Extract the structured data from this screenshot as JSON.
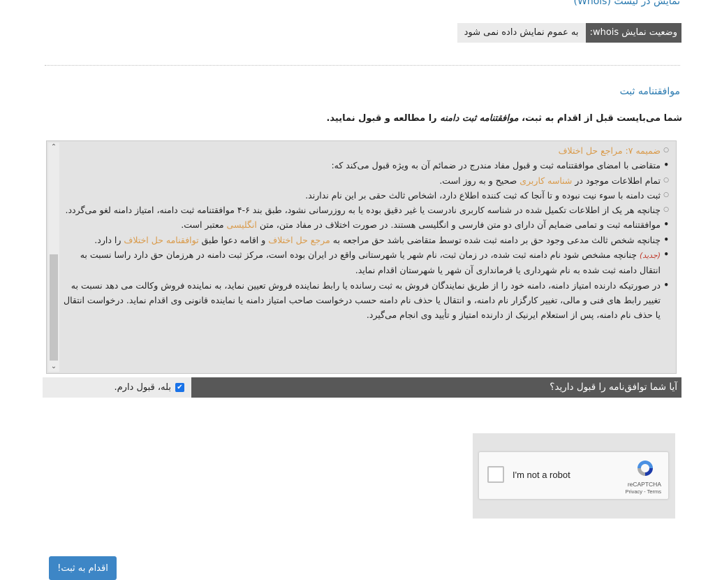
{
  "whois": {
    "title": "نمایش در لیست (Whois)",
    "status_label": "وضعیت نمایش whois:",
    "status_value": "به عموم نمایش داده نمی شود"
  },
  "agreement": {
    "title": "موافقتنامه ثبت",
    "intro_part1": "شما می‌بایست قبل از اقدام به ثبت، ",
    "intro_link": "موافقتنامه ثبت دامنه",
    "intro_part2": " را مطالعه و قبول نمایید.",
    "items": {
      "annex7": "ضمیمه ۷: مراجع حل اختلاف",
      "applicant": "متقاضی با امضای موافقتنامه ثبت و قبول مفاد مندرج در ضمائم آن به ویژه قبول می‌کند که:",
      "info_a": "تمام اطلاعات موجود در ",
      "info_link": "شناسه کاربری",
      "info_b": " صحیح و به روز است.",
      "third_party": "ثبت دامنه با سوء نیت نبوده و تا آنجا که ثبت کننده اطلاع دارد، اشخاص ثالث حقی بر این نام ندارند.",
      "cancel": "چنانچه هر یک از اطلاعات تکمیل شده در شناسه کاربری نادرست یا غیر دقیق بوده یا به روزرسانی نشود، طبق بند ۶-۴ موافقتنامه ثبت دامنه، امتیاز دامنه لغو می‌گردد.",
      "lang_a": "موافقتنامه ثبت و تمامی ضمایم آن دارای دو متن فارسی و انگلیسی هستند. در صورت اختلاف در مفاد متن، متن ",
      "lang_link": "انگلیسی",
      "lang_b": " معتبر است.",
      "claim_a": "چنانچه شخص ثالث مدعی وجود حق بر دامنه ثبت شده توسط متقاضی باشد حق مراجعه به ",
      "claim_link1": "مرجع حل اختلاف",
      "claim_b": " و اقامه دعوا طبق ",
      "claim_link2": "توافقنامه حل اختلاف",
      "claim_c": " را دارد.",
      "new_tag": "(جدید)",
      "city": " چنانچه مشخص شود نام دامنه ثبت شده، در زمان ثبت، نام شهر یا شهرستانی واقع در ایران بوده است، مرکز ثبت دامنه در هرزمان حق دارد راسا نسبت به انتقال دامنه ثبت شده به نام شهرداری یا فرمانداری آن شهر یا شهرستان اقدام نماید.",
      "agent": "در صورتیکه دارنده امتیاز دامنه، دامنه خود را از طریق نمایندگان فروش به ثبت رسانده یا رابط نماینده فروش تعیین نماید، به نماینده فروش وکالت می دهد نسبت به تغییر رابط های فنی و مالی، تغییر کارگزار نام دامنه، و انتقال یا حذف نام دامنه حسب درخواست صاحب امتیاز دامنه یا نماینده قانونی وی اقدام نماید. درخواست انتقال یا حذف نام دامنه، پس از استعلام ایرنیک از دارنده امتیاز و تأیید وی انجام می‌گیرد."
    }
  },
  "accept": {
    "question": "آیا شما توافق‌نامه را قبول دارید؟",
    "answer": "بله، قبول دارم."
  },
  "recaptcha": {
    "label": "I'm not a robot",
    "brand": "reCAPTCHA",
    "privacy": "Privacy",
    "separator": " - ",
    "terms": "Terms"
  },
  "submit": {
    "label": "اقدام به ثبت!"
  },
  "colors": {
    "accent": "#2a7ab0",
    "link": "#d99a4a",
    "dark_bar": "#585858",
    "button": "#3d86c6"
  }
}
